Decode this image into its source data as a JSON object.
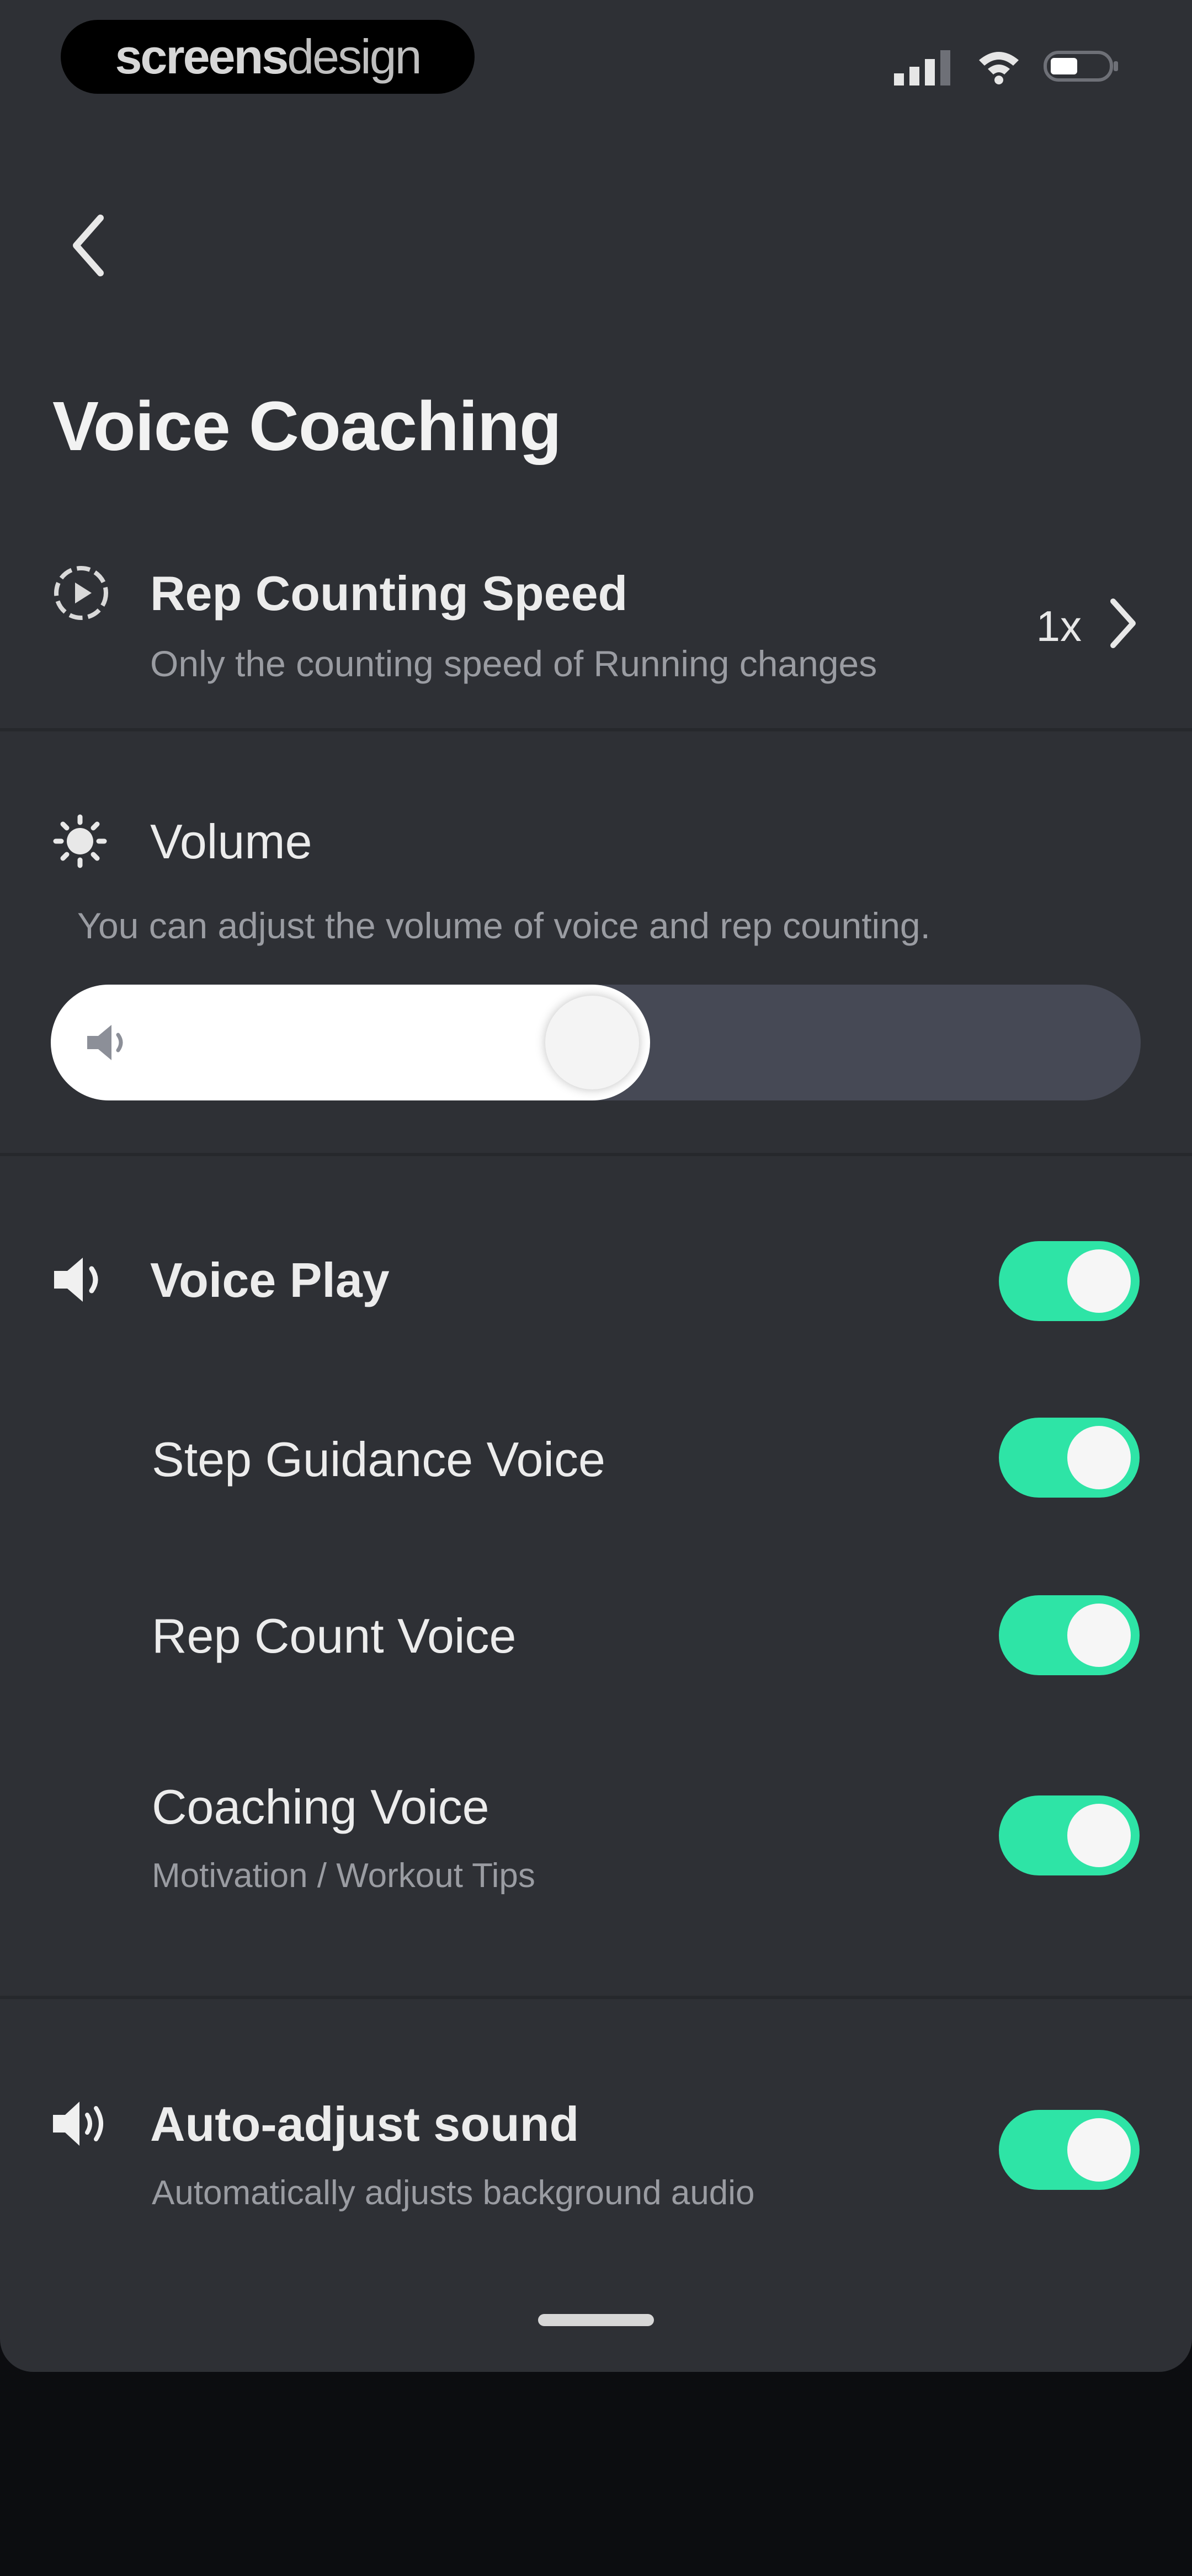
{
  "status_bar": {
    "brand_bold": "screens",
    "brand_light": "design",
    "icons": [
      "signal-icon",
      "wifi-icon",
      "battery-icon"
    ]
  },
  "header": {
    "back_icon": "chevron-left-icon",
    "title": "Voice Coaching"
  },
  "rep_speed": {
    "icon": "play-circle-icon",
    "title": "Rep Counting Speed",
    "subtitle": "Only the counting speed of Running changes",
    "value": "1x",
    "chevron_icon": "chevron-right-icon"
  },
  "volume": {
    "icon": "sun-icon",
    "title": "Volume",
    "subtitle": "You can adjust the volume of voice and rep counting.",
    "level": 0.55,
    "slider_icon": "speaker-icon"
  },
  "voice_play": {
    "icon": "speaker-icon",
    "title": "Voice Play",
    "enabled": true,
    "items": [
      {
        "title": "Step Guidance Voice",
        "subtitle": "",
        "enabled": true
      },
      {
        "title": "Rep Count Voice",
        "subtitle": "",
        "enabled": true
      },
      {
        "title": "Coaching Voice",
        "subtitle": "Motivation / Workout Tips",
        "enabled": true
      }
    ]
  },
  "auto_adjust": {
    "icon": "speaker-waves-icon",
    "title": "Auto-adjust sound",
    "subtitle": "Automatically adjusts background audio",
    "enabled": true
  },
  "colors": {
    "background": "#2e3035",
    "toggle_on": "#2ee4a6",
    "slider_track": "#464955",
    "text": "#ececec",
    "subtext": "#9a9ca2"
  }
}
